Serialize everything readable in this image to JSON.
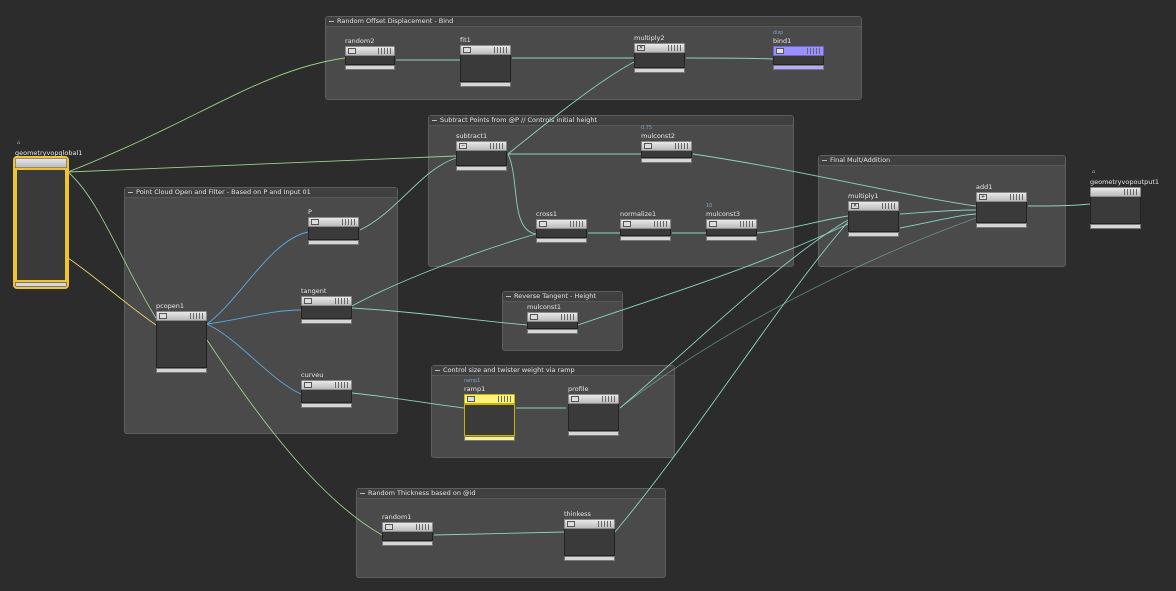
{
  "boxes": {
    "random_offset": "Random Offset Displacement - Bind",
    "subtract_points": "Subtract Points from @P // Controls initial height",
    "final_mult": "Final Mult/Addition",
    "point_cloud": "Point Cloud Open and Filter - Based on P and Input 01",
    "reverse_tangent": "Reverse Tangent - Height",
    "control_size": "Control size and twister weight via ramp",
    "random_thickness": "Random Thickness based on @id"
  },
  "nodes": {
    "geometryvopglobal1": "geometryvopglobal1",
    "random2": "random2",
    "fit1": "fit1",
    "multiply2": "multiply2",
    "bind1": "bind1",
    "bind1_sub": "disp",
    "subtract1": "subtract1",
    "mulconst2": "mulconst2",
    "mulconst2_sub": "0.75",
    "cross1": "cross1",
    "normalize1": "normalize1",
    "mulconst3": "mulconst3",
    "mulconst3_sub": "10",
    "multiply1": "multiply1",
    "add1": "add1",
    "geometryvopoutput1": "geometryvopoutput1",
    "P": "P",
    "tangent": "tangent",
    "pcopen1": "pcopen1",
    "curveu": "curveu",
    "mulconst1": "mulconst1",
    "ramp1": "ramp1",
    "ramp1_sub": "ramp1",
    "profile": "profile",
    "random1": "random1",
    "thinkess": "thinkess"
  }
}
